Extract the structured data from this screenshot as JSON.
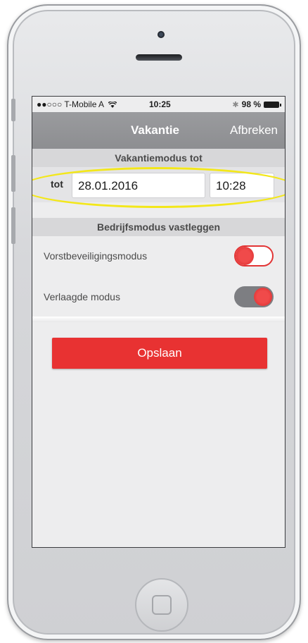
{
  "status_bar": {
    "carrier": "●●○○○ T-Mobile A",
    "wifi_icon": "wifi-icon",
    "time": "10:25",
    "bluetooth_icon": "bluetooth-icon",
    "battery": "98 %"
  },
  "nav": {
    "title": "Vakantie",
    "cancel_label": "Afbreken"
  },
  "vacation_section": {
    "header": "Vakantiemodus tot",
    "to_label": "tot",
    "date_value": "28.01.2016",
    "time_value": "10:28"
  },
  "mode_section": {
    "header": "Bedrijfsmodus vastleggen",
    "items": [
      {
        "label": "Vorstbeveiligingsmodus",
        "enabled": false
      },
      {
        "label": "Verlaagde modus",
        "enabled": true
      }
    ]
  },
  "save_label": "Opslaan",
  "colors": {
    "accent": "#e83232",
    "highlight": "#f3e71a",
    "navbar": "#8d8e91"
  }
}
